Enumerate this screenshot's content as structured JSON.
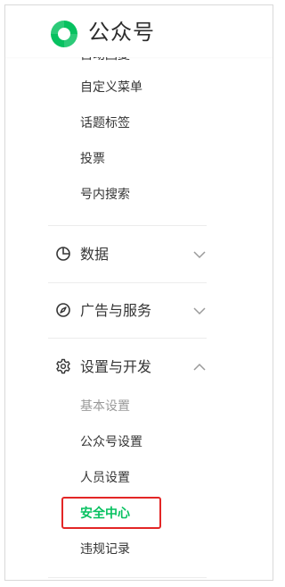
{
  "app": {
    "name": "公众号",
    "brand_color": "#07c160"
  },
  "menu": {
    "clipped_item": "自动回复",
    "feature_items": [
      "自定义菜单",
      "话题标签",
      "投票",
      "号内搜索"
    ],
    "sections": [
      {
        "label": "数据",
        "icon": "chart-pie-icon",
        "expanded": false
      },
      {
        "label": "广告与服务",
        "icon": "compass-icon",
        "expanded": false
      },
      {
        "label": "设置与开发",
        "icon": "gear-icon",
        "expanded": true
      }
    ],
    "settings_items": [
      {
        "label": "基本设置",
        "state": "muted"
      },
      {
        "label": "公众号设置",
        "state": "normal"
      },
      {
        "label": "人员设置",
        "state": "normal"
      },
      {
        "label": "安全中心",
        "state": "active"
      },
      {
        "label": "违规记录",
        "state": "normal"
      }
    ],
    "highlight_color": "#e32626"
  }
}
